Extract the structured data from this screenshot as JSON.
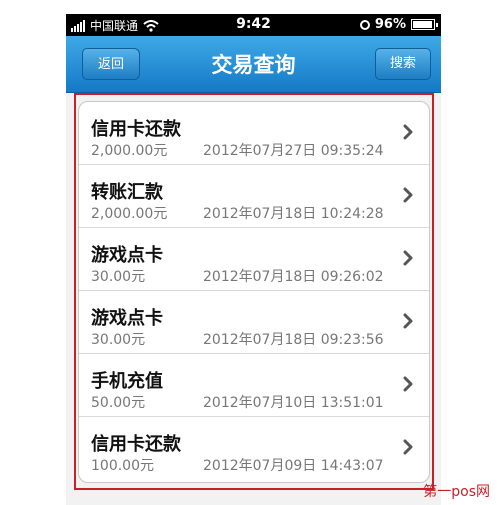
{
  "status_bar": {
    "carrier": "中国联通",
    "time": "9:42",
    "battery": "96%",
    "battery_level": 0.96
  },
  "nav": {
    "back_label": "返回",
    "title": "交易查询",
    "search_label": "搜索"
  },
  "transactions": [
    {
      "title": "信用卡还款",
      "amount": "2,000.00元",
      "time": "2012年07月27日 09:35:24"
    },
    {
      "title": "转账汇款",
      "amount": "2,000.00元",
      "time": "2012年07月18日 10:24:28"
    },
    {
      "title": "游戏点卡",
      "amount": "30.00元",
      "time": "2012年07月18日 09:26:02"
    },
    {
      "title": "游戏点卡",
      "amount": "30.00元",
      "time": "2012年07月18日 09:23:56"
    },
    {
      "title": "手机充值",
      "amount": "50.00元",
      "time": "2012年07月10日 13:51:01"
    },
    {
      "title": "信用卡还款",
      "amount": "100.00元",
      "time": "2012年07月09日 14:43:07"
    }
  ],
  "watermark": "第一pos网",
  "colors": {
    "nav_top": "#3fa9e6",
    "nav_bottom": "#1479c7",
    "highlight": "#c8202a"
  }
}
